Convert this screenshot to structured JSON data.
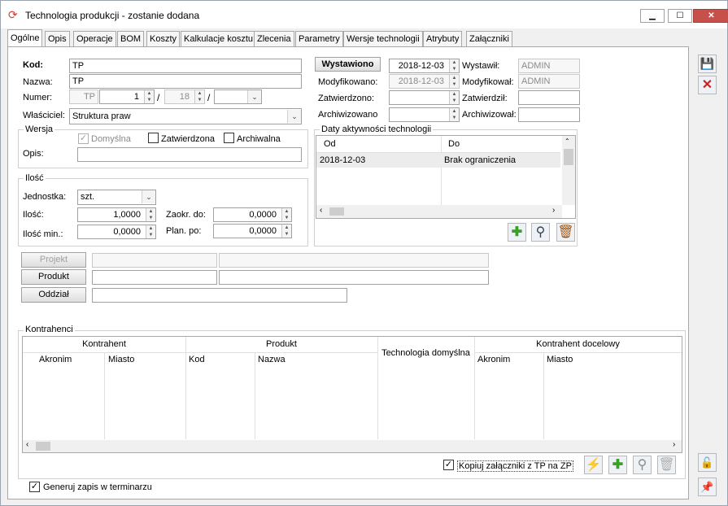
{
  "window": {
    "title": "Technologia produkcji - zostanie dodana",
    "minimize": "▁",
    "maximize": "☐",
    "close": "✕"
  },
  "tabs": [
    "Ogólne",
    "Opis",
    "Operacje",
    "BOM",
    "Koszty",
    "Kalkulacje kosztu",
    "Zlecenia",
    "Parametry",
    "Wersje technologii",
    "Atrybuty",
    "Załączniki"
  ],
  "form": {
    "kod_label": "Kod:",
    "kod_value": "TP",
    "nazwa_label": "Nazwa:",
    "nazwa_value": "TP",
    "numer_label": "Numer:",
    "numer_prefix": "TP",
    "numer_part1": "1",
    "numer_sep": "/",
    "numer_part2": "18",
    "wlasciciel_label": "Właściciel:",
    "wlasciciel_value": "Struktura praw"
  },
  "wersja": {
    "title": "Wersja",
    "domyslna": "Domyślna",
    "zatwierdzona": "Zatwierdzona",
    "archiwalna": "Archiwalna",
    "opis_label": "Opis:",
    "opis_value": ""
  },
  "ilosc": {
    "title": "Ilość",
    "jednostka_label": "Jednostka:",
    "jednostka_value": "szt.",
    "ilosc_label": "Ilość:",
    "ilosc_value": "1,0000",
    "ilosc_min_label": "Ilość min.:",
    "ilosc_min_value": "0,0000",
    "zaokr_label": "Zaokr. do:",
    "zaokr_value": "0,0000",
    "plan_label": "Plan. po:",
    "plan_value": "0,0000"
  },
  "status": {
    "wystawiono_button": "Wystawiono",
    "wystawiono_date": "2018-12-03",
    "modyfikowano_label": "Modyfikowano:",
    "modyfikowano_date": "2018-12-03",
    "zatwierdzono_label": "Zatwierdzono:",
    "archiwizowano_label": "Archiwizowano",
    "wystawil_label": "Wystawił:",
    "wystawil_value": "ADMIN",
    "modyfikowal_label": "Modyfikował:",
    "modyfikowal_value": "ADMIN",
    "zatwierdzil_label": "Zatwierdził:",
    "archiwizowal_label": "Archiwizował:"
  },
  "daty": {
    "title": "Daty aktywności technologii",
    "columns": [
      "Od",
      "Do"
    ],
    "rows": [
      [
        "2018-12-03",
        "Brak ograniczenia"
      ]
    ]
  },
  "links": {
    "projekt": "Projekt",
    "produkt": "Produkt",
    "oddzial": "Oddział"
  },
  "kontrahenci": {
    "title": "Kontrahenci",
    "group_kontrahent": "Kontrahent",
    "group_produkt": "Produkt",
    "technologia_domyslna": "Technologia domyślna",
    "group_docelowy": "Kontrahent docelowy",
    "col_akronim": "Akronim",
    "col_miasto": "Miasto",
    "col_kod": "Kod",
    "col_nazwa": "Nazwa",
    "col_akronim2": "Akronim",
    "col_miasto2": "Miasto"
  },
  "kopiuj_label": "Kopiuj załączniki z TP na ZP",
  "generuj_label": "Generuj zapis w terminarzu",
  "colors": {
    "close": "#c7504a",
    "accent_green": "#3aa02a",
    "delete_red": "#d02020"
  }
}
